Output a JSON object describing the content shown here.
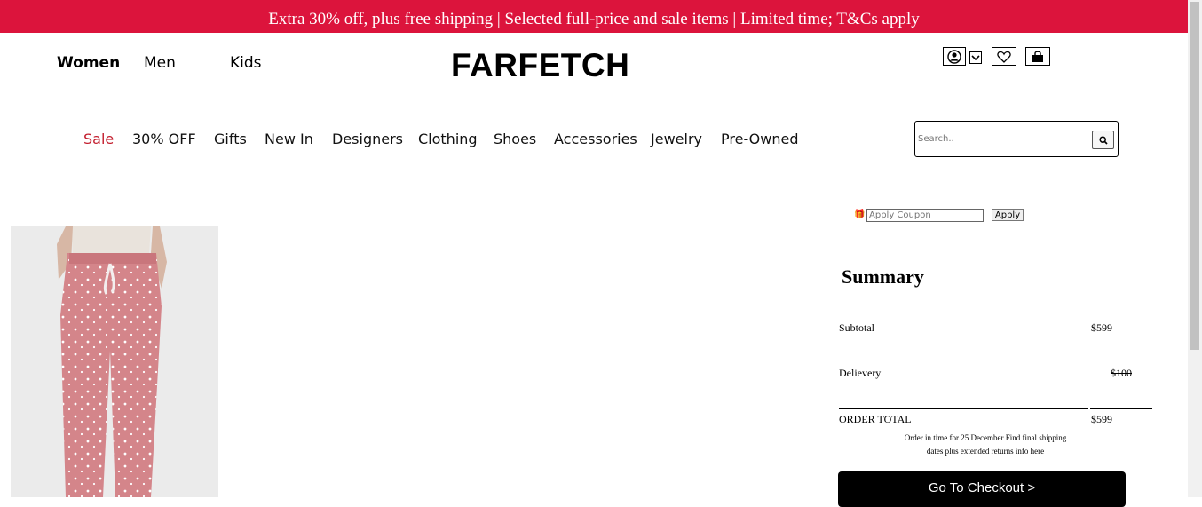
{
  "promo_banner": "Extra 30% off, plus free shipping | Selected full-price and sale items | Limited time; T&Cs apply",
  "gender_nav": [
    "Women",
    "Men",
    "Kids"
  ],
  "logo": "FARFETCH",
  "header_icons": [
    "user-icon",
    "chevron-down-icon",
    "heart-icon",
    "shopping-bag-icon"
  ],
  "category_nav": [
    "Sale",
    "30% OFF",
    "Gifts",
    "New In",
    "Designers",
    "Clothing",
    "Shoes",
    "Accessories",
    "Jewelry",
    "Pre-Owned"
  ],
  "search": {
    "placeholder": "Search.."
  },
  "coupon": {
    "placeholder": "Apply Coupon",
    "button": "Apply"
  },
  "summary": {
    "title": "Summary",
    "subtotal_label": "Subtotal",
    "subtotal_value": "$599",
    "delivery_label": "Delievery",
    "delivery_value": "$100",
    "total_label": "ORDER TOTAL",
    "total_value": "$599",
    "note_line1": "Order in time for 25 December Find final shipping",
    "note_line2": "dates plus extended returns info here",
    "checkout_button": "Go To Checkout >"
  },
  "colors": {
    "banner": "#dc143c",
    "sale": "#c31e2e",
    "checkout": "#000000"
  }
}
